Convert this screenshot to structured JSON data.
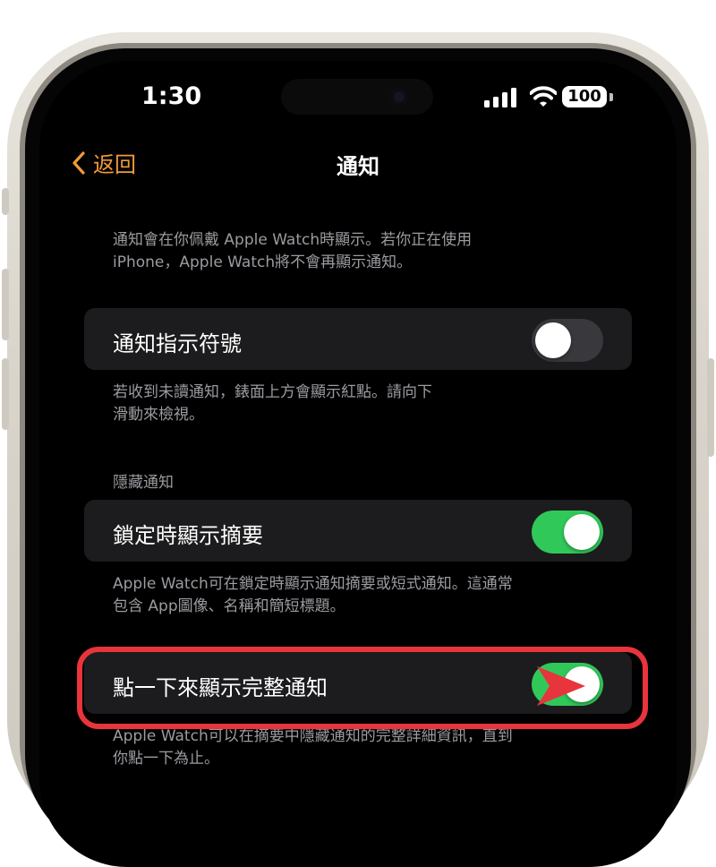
{
  "status_bar": {
    "time": "1:30",
    "battery": "100"
  },
  "nav": {
    "back_label": "返回",
    "title": "通知"
  },
  "intro_note": {
    "line1": "通知會在你佩戴 Apple Watch時顯示。若你正在使用",
    "line2": "iPhone，Apple Watch將不會再顯示通知。"
  },
  "rows": {
    "indicator": {
      "label": "通知指示符號",
      "on": false,
      "note_line1": "若收到未讀通知，錶面上方會顯示紅點。請向下",
      "note_line2": "滑動來檢視。"
    },
    "hide_section_header": "隱藏通知",
    "summary": {
      "label": "鎖定時顯示摘要",
      "on": true,
      "note_line1": "Apple Watch可在鎖定時顯示通知摘要或短式通知。這通常",
      "note_line2": "包含 App圖像、名稱和簡短標題。"
    },
    "tap_full": {
      "label": "點一下來顯示完整通知",
      "on": true,
      "note_line1": "Apple Watch可以在摘要中隱藏通知的完整詳細資訊，直到",
      "note_line2": "你點一下為止。"
    }
  },
  "colors": {
    "accent": "#f19a37",
    "toggle_on": "#31c85a",
    "toggle_off": "#39393d",
    "highlight": "#e8343c"
  },
  "icons": [
    "chevron-left-icon",
    "cellular-signal-icon",
    "wifi-icon",
    "battery-icon",
    "arrow-pointer-icon"
  ]
}
